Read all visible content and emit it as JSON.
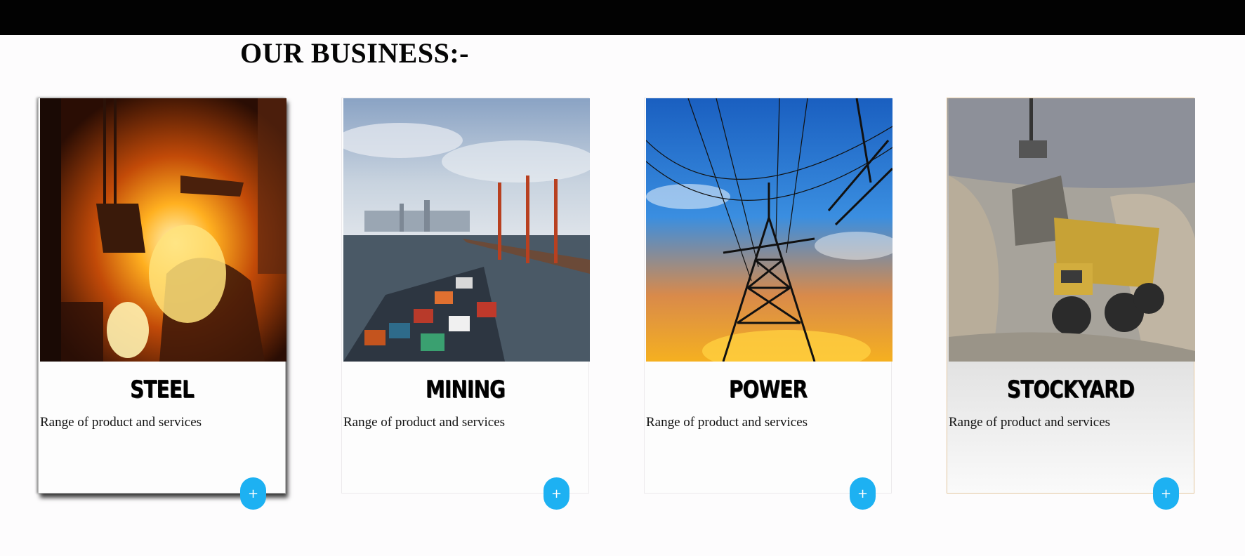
{
  "page": {
    "title": "OUR BUSINESS:-"
  },
  "cards": [
    {
      "title": "STEEL",
      "description": "Range of product and services",
      "image": "steel-furnace-image",
      "button": "+"
    },
    {
      "title": "MINING",
      "description": "Range of product and services",
      "image": "port-cargo-ship-image",
      "button": "+"
    },
    {
      "title": "POWER",
      "description": "Range of product and services",
      "image": "power-transmission-tower-image",
      "button": "+"
    },
    {
      "title": "STOCKYARD",
      "description": "Range of product and services",
      "image": "mining-dump-truck-image",
      "button": "+"
    }
  ],
  "colors": {
    "topbar": "#020202",
    "button": "#1db1f2",
    "background": "#fdfcfd"
  }
}
